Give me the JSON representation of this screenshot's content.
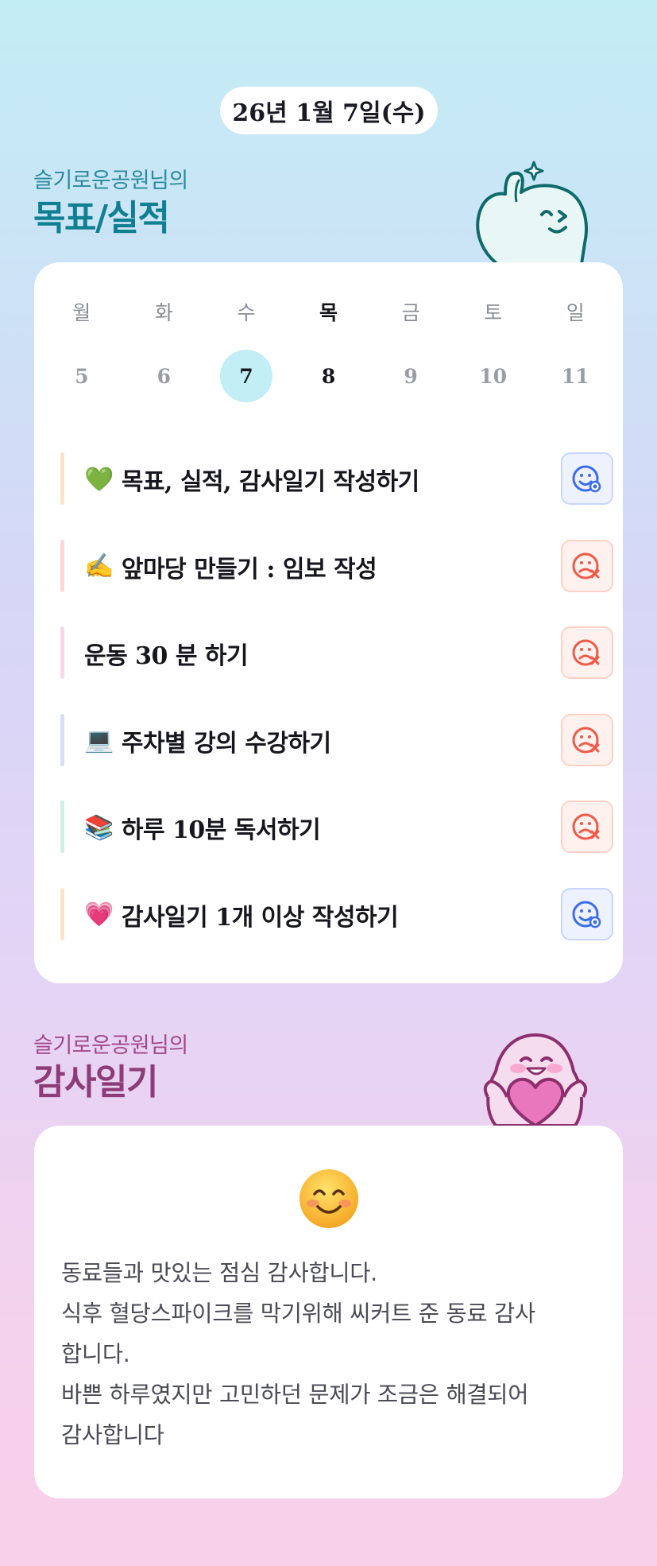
{
  "header": {
    "date": "26년 1월 7일(수)"
  },
  "goals_section": {
    "owner": "슬기로운공원님의",
    "title": "목표/실적"
  },
  "calendar": {
    "weekdays": [
      "월",
      "화",
      "수",
      "목",
      "금",
      "토",
      "일"
    ],
    "dates": [
      "5",
      "6",
      "7",
      "8",
      "9",
      "10",
      "11"
    ],
    "selected_index": 2,
    "today_index": 3
  },
  "goals": [
    {
      "emoji": "💚",
      "text": "목표, 실적, 감사일기 작성하기",
      "status": "done",
      "bar_color": "#fde3c7"
    },
    {
      "emoji": "✍️",
      "text": "앞마당 만들기 : 임보 작성",
      "status": "fail",
      "bar_color": "#ffd5d5"
    },
    {
      "emoji": "",
      "text": "운동 30 분 하기",
      "status": "fail",
      "bar_color": "#fbd5ee"
    },
    {
      "emoji": "💻",
      "text": "주차별 강의 수강하기",
      "status": "fail",
      "bar_color": "#d8defa"
    },
    {
      "emoji": "📚",
      "text": "하루 10분 독서하기",
      "status": "fail",
      "bar_color": "#cdf1e0"
    },
    {
      "emoji": "💗",
      "text": "감사일기 1개 이상 작성하기",
      "status": "done",
      "bar_color": "#fde3c7"
    }
  ],
  "thanks_section": {
    "owner": "슬기로운공원님의",
    "title": "감사일기"
  },
  "thanks": {
    "mood": "smiling-face",
    "lines": [
      "동료들과 맛있는 점심 감사합니다.",
      "식후 혈당스파이크를 막기위해 씨커트 준 동료 감사",
      "합니다.",
      "바쁜 하루였지만 고민하던 문제가 조금은 해결되어",
      "감사합니다"
    ]
  },
  "colors": {
    "done": "#3a6cf0",
    "fail": "#ef5a48",
    "accent_teal": "#117f92",
    "accent_plum": "#8e3c78"
  }
}
